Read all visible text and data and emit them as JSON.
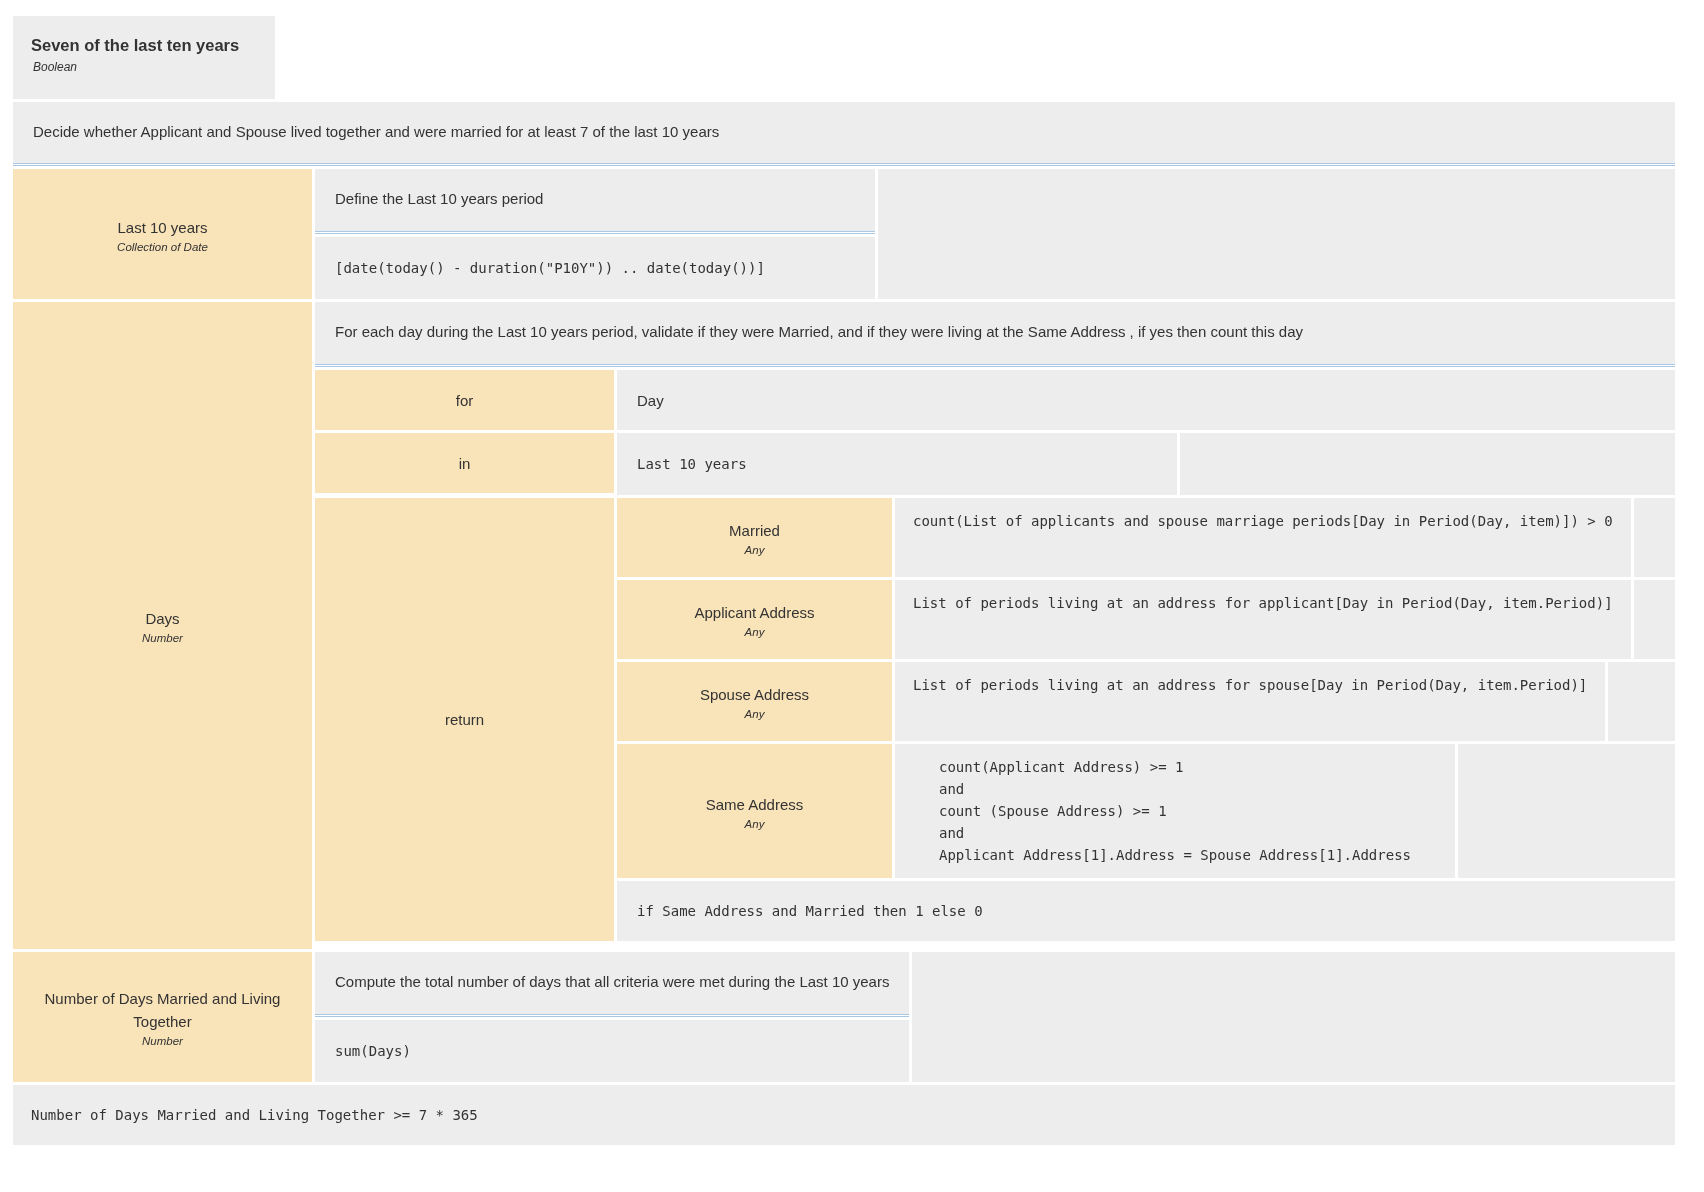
{
  "title": "Seven of the last ten years",
  "type_ref": "Boolean",
  "description": "Decide whether Applicant and Spouse lived together and were married for at least 7 of the last 10 years",
  "entries": [
    {
      "kind": "literal",
      "name": "Last 10 years",
      "type_ref": "Collection of Date",
      "description": "Define the Last 10 years period",
      "expression": "[date(today() - duration(\"P10Y\")) .. date(today())]"
    },
    {
      "kind": "iterator",
      "name": "Days",
      "type_ref": "Number",
      "description": "For each day during the Last 10 years period, validate if they were Married, and if they were living at the Same Address , if yes then count this day",
      "for_label": "for",
      "variable": "Day",
      "in_label": "in",
      "in_expression": "Last 10 years",
      "return_label": "return",
      "context": {
        "entries": [
          {
            "name": "Married",
            "type_ref": "Any",
            "expression": "count(List of applicants and spouse marriage periods[Day in Period(Day, item)]) > 0"
          },
          {
            "name": "Applicant Address",
            "type_ref": "Any",
            "expression": "List of periods living at an address for applicant[Day in Period(Day, item.Period)]"
          },
          {
            "name": "Spouse Address",
            "type_ref": "Any",
            "expression": "List of periods living at an address for spouse[Day in Period(Day, item.Period)]"
          },
          {
            "name": "Same Address",
            "type_ref": "Any",
            "expression": "count(Applicant Address) >= 1\nand\ncount (Spouse Address) >= 1\nand\nApplicant Address[1].Address = Spouse Address[1].Address"
          }
        ],
        "result": "if Same Address and Married then 1 else 0"
      }
    },
    {
      "kind": "literal",
      "name": "Number of Days Married and Living Together",
      "type_ref": "Number",
      "description": "Compute the total number of days that all criteria were met during the Last 10 years",
      "expression": "sum(Days)"
    }
  ],
  "result": "Number of Days Married and Living Together >= 7 * 365"
}
